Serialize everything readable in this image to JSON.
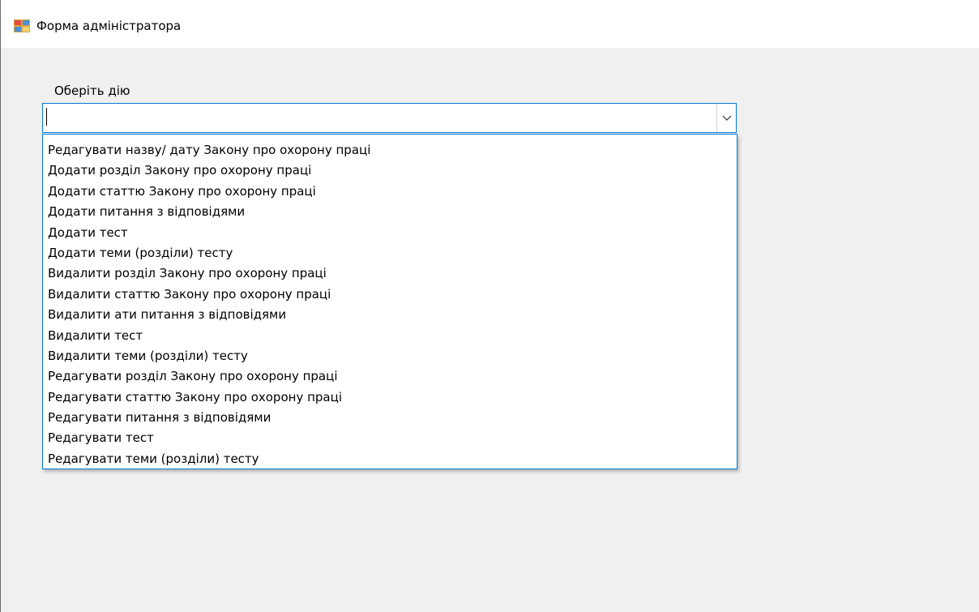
{
  "window": {
    "title": "Форма адміністратора",
    "icon": "app-form-icon"
  },
  "action_select": {
    "label": "Оберіть дію",
    "value": "",
    "options": [
      "Редагувати назву/ дату Закону про охорону праці",
      "Додати розділ Закону про охорону праці",
      "Додати статтю Закону про охорону праці",
      "Додати питання з відповідями",
      "Додати тест",
      "Додати теми (розділи) тесту",
      "Видалити розділ Закону про охорону праці",
      "Видалити статтю Закону про охорону праці",
      "Видалити ати питання з відповідями",
      "Видалити тест",
      "Видалити теми (розділи) тесту",
      "Редагувати розділ Закону про охорону праці",
      "Редагувати статтю Закону про охорону праці",
      "Редагувати питання з відповідями",
      "Редагувати тест",
      "Редагувати теми (розділи) тесту"
    ]
  },
  "colors": {
    "accent": "#0078d7",
    "client_background": "#f0f0f0",
    "titlebar_background": "#ffffff"
  }
}
